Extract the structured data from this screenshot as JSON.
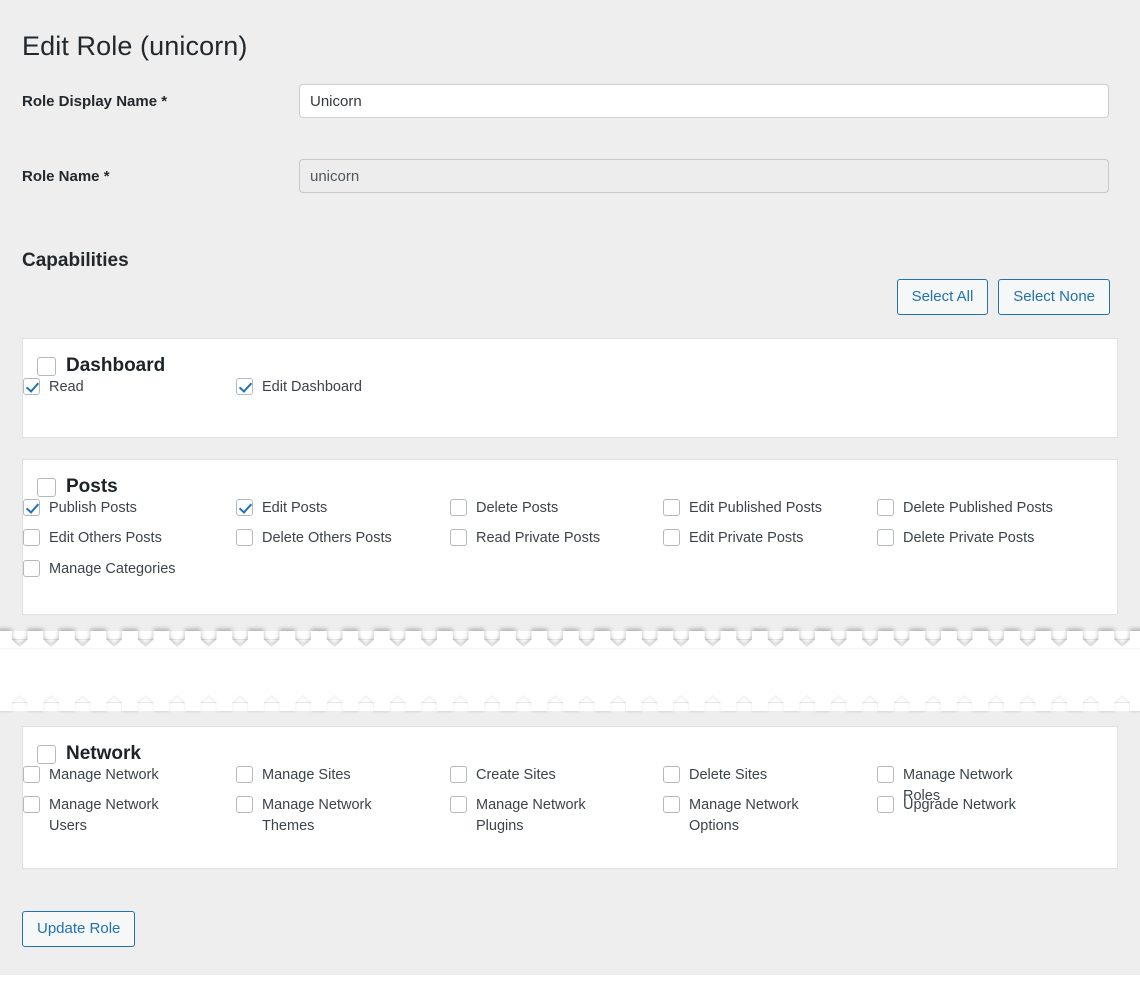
{
  "page": {
    "title": "Edit Role (unicorn)",
    "capabilities_heading": "Capabilities"
  },
  "form": {
    "display_name": {
      "label": "Role Display Name *",
      "value": "Unicorn",
      "readonly": false
    },
    "role_name": {
      "label": "Role Name *",
      "value": "unicorn",
      "readonly": true
    }
  },
  "toolbar": {
    "select_all_label": "Select All",
    "select_none_label": "Select None"
  },
  "footer": {
    "update_label": "Update Role"
  },
  "colors": {
    "accent": "#2271b1",
    "page_bg": "#eeeeee",
    "box_bg": "#ffffff",
    "box_border": "#e0e0e0",
    "text": "#3c434a"
  },
  "groups": [
    {
      "name": "Dashboard",
      "checked": false,
      "items": [
        {
          "label": "Read",
          "checked": true,
          "col": 0,
          "row": 0
        },
        {
          "label": "Edit Dashboard",
          "checked": true,
          "col": 1,
          "row": 0
        }
      ]
    },
    {
      "name": "Posts",
      "checked": false,
      "items": [
        {
          "label": "Publish Posts",
          "checked": true,
          "col": 0,
          "row": 0
        },
        {
          "label": "Edit Posts",
          "checked": true,
          "col": 1,
          "row": 0
        },
        {
          "label": "Delete Posts",
          "checked": false,
          "col": 2,
          "row": 0
        },
        {
          "label": "Edit Published Posts",
          "checked": false,
          "col": 3,
          "row": 0
        },
        {
          "label": "Delete Published Posts",
          "checked": false,
          "col": 4,
          "row": 0
        },
        {
          "label": "Edit Others Posts",
          "checked": false,
          "col": 0,
          "row": 1
        },
        {
          "label": "Delete Others Posts",
          "checked": false,
          "col": 1,
          "row": 1
        },
        {
          "label": "Read Private Posts",
          "checked": false,
          "col": 2,
          "row": 1
        },
        {
          "label": "Edit Private Posts",
          "checked": false,
          "col": 3,
          "row": 1
        },
        {
          "label": "Delete Private Posts",
          "checked": false,
          "col": 4,
          "row": 1
        },
        {
          "label": "Manage Categories",
          "checked": false,
          "col": 0,
          "row": 2
        }
      ]
    },
    {
      "name": "Network",
      "checked": false,
      "items": [
        {
          "label": "Manage Network",
          "checked": false,
          "col": 0,
          "row": 0
        },
        {
          "label": "Manage Sites",
          "checked": false,
          "col": 1,
          "row": 0
        },
        {
          "label": "Create Sites",
          "checked": false,
          "col": 2,
          "row": 0
        },
        {
          "label": "Delete Sites",
          "checked": false,
          "col": 3,
          "row": 0
        },
        {
          "label": "Manage Network Roles",
          "checked": false,
          "col": 4,
          "row": 0
        },
        {
          "label": "Manage Network Users",
          "checked": false,
          "col": 0,
          "row": 1
        },
        {
          "label": "Manage Network Themes",
          "checked": false,
          "col": 1,
          "row": 1
        },
        {
          "label": "Manage Network Plugins",
          "checked": false,
          "col": 2,
          "row": 1
        },
        {
          "label": "Manage Network Options",
          "checked": false,
          "col": 3,
          "row": 1
        },
        {
          "label": "Upgrade Network",
          "checked": false,
          "col": 4,
          "row": 1
        }
      ]
    }
  ],
  "truncation": {
    "style": "torn-paper",
    "note": "content omitted between Posts and Network sections"
  }
}
